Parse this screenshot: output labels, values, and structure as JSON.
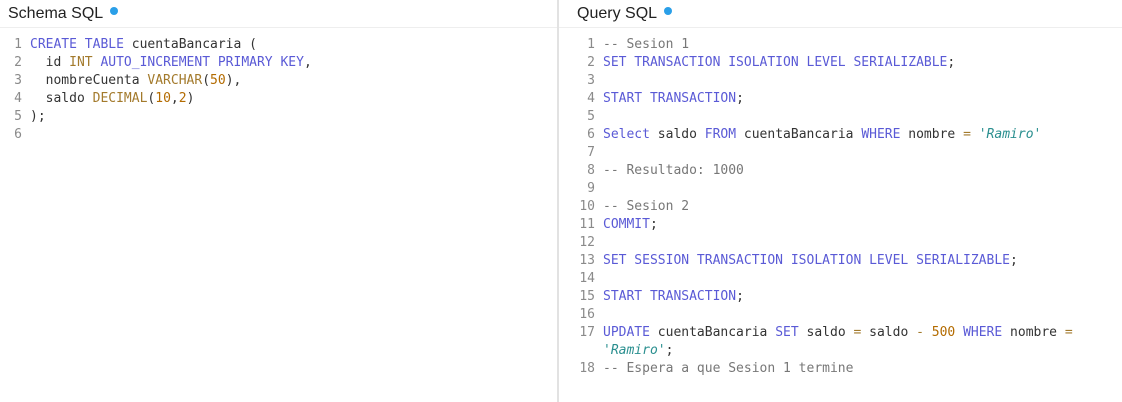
{
  "schema": {
    "title": "Schema SQL",
    "lines": [
      {
        "n": "1",
        "tokens": [
          {
            "t": "kw",
            "v": "CREATE TABLE"
          },
          {
            "t": "id",
            "v": " cuentaBancaria ("
          }
        ]
      },
      {
        "n": "2",
        "tokens": [
          {
            "t": "id",
            "v": "  id "
          },
          {
            "t": "type",
            "v": "INT"
          },
          {
            "t": "kw",
            "v": " AUTO_INCREMENT PRIMARY KEY"
          },
          {
            "t": "p",
            "v": ","
          }
        ]
      },
      {
        "n": "3",
        "tokens": [
          {
            "t": "id",
            "v": "  nombreCuenta "
          },
          {
            "t": "type",
            "v": "VARCHAR"
          },
          {
            "t": "p",
            "v": "("
          },
          {
            "t": "num",
            "v": "50"
          },
          {
            "t": "p",
            "v": "),"
          }
        ]
      },
      {
        "n": "4",
        "tokens": [
          {
            "t": "id",
            "v": "  saldo "
          },
          {
            "t": "type",
            "v": "DECIMAL"
          },
          {
            "t": "p",
            "v": "("
          },
          {
            "t": "num",
            "v": "10"
          },
          {
            "t": "p",
            "v": ","
          },
          {
            "t": "num",
            "v": "2"
          },
          {
            "t": "p",
            "v": ")"
          }
        ]
      },
      {
        "n": "5",
        "tokens": [
          {
            "t": "p",
            "v": ");"
          }
        ]
      },
      {
        "n": "6",
        "tokens": []
      }
    ]
  },
  "query": {
    "title": "Query SQL",
    "lines": [
      {
        "n": "1",
        "tokens": [
          {
            "t": "cm",
            "v": "-- Sesion 1"
          }
        ]
      },
      {
        "n": "2",
        "tokens": [
          {
            "t": "kw",
            "v": "SET TRANSACTION ISOLATION LEVEL SERIALIZABLE"
          },
          {
            "t": "p",
            "v": ";"
          }
        ]
      },
      {
        "n": "3",
        "tokens": []
      },
      {
        "n": "4",
        "tokens": [
          {
            "t": "kw",
            "v": "START TRANSACTION"
          },
          {
            "t": "p",
            "v": ";"
          }
        ]
      },
      {
        "n": "5",
        "tokens": []
      },
      {
        "n": "6",
        "tokens": [
          {
            "t": "kw",
            "v": "Select"
          },
          {
            "t": "id",
            "v": " saldo "
          },
          {
            "t": "kw",
            "v": "FROM"
          },
          {
            "t": "id",
            "v": " cuentaBancaria "
          },
          {
            "t": "kw",
            "v": "WHERE"
          },
          {
            "t": "id",
            "v": " nombre "
          },
          {
            "t": "op",
            "v": "="
          },
          {
            "t": "id",
            "v": " "
          },
          {
            "t": "str",
            "v": "'Ramiro'"
          }
        ]
      },
      {
        "n": "7",
        "tokens": []
      },
      {
        "n": "8",
        "tokens": [
          {
            "t": "cm",
            "v": "-- Resultado: 1000"
          }
        ]
      },
      {
        "n": "9",
        "tokens": []
      },
      {
        "n": "10",
        "tokens": [
          {
            "t": "cm",
            "v": "-- Sesion 2"
          }
        ]
      },
      {
        "n": "11",
        "tokens": [
          {
            "t": "kw",
            "v": "COMMIT"
          },
          {
            "t": "p",
            "v": ";"
          }
        ]
      },
      {
        "n": "12",
        "tokens": []
      },
      {
        "n": "13",
        "tokens": [
          {
            "t": "kw",
            "v": "SET SESSION TRANSACTION ISOLATION LEVEL SERIALIZABLE"
          },
          {
            "t": "p",
            "v": ";"
          }
        ]
      },
      {
        "n": "14",
        "tokens": []
      },
      {
        "n": "15",
        "tokens": [
          {
            "t": "kw",
            "v": "START TRANSACTION"
          },
          {
            "t": "p",
            "v": ";"
          }
        ]
      },
      {
        "n": "16",
        "tokens": []
      },
      {
        "n": "17",
        "tokens": [
          {
            "t": "kw",
            "v": "UPDATE"
          },
          {
            "t": "id",
            "v": " cuentaBancaria "
          },
          {
            "t": "kw",
            "v": "SET"
          },
          {
            "t": "id",
            "v": " saldo "
          },
          {
            "t": "op",
            "v": "="
          },
          {
            "t": "id",
            "v": " saldo "
          },
          {
            "t": "op",
            "v": "-"
          },
          {
            "t": "id",
            "v": " "
          },
          {
            "t": "num",
            "v": "500"
          },
          {
            "t": "id",
            "v": " "
          },
          {
            "t": "kw",
            "v": "WHERE"
          },
          {
            "t": "id",
            "v": " nombre "
          },
          {
            "t": "op",
            "v": "="
          }
        ]
      },
      {
        "n": "",
        "tokens": [
          {
            "t": "str",
            "v": "'Ramiro'"
          },
          {
            "t": "p",
            "v": ";"
          }
        ]
      },
      {
        "n": "18",
        "tokens": [
          {
            "t": "cm",
            "v": "-- Espera a que Sesion 1 termine"
          }
        ]
      }
    ]
  },
  "colors": {
    "accent": "#2a9fe8",
    "keyword": "#5a5ad6",
    "type": "#a37a2c",
    "number": "#b36b00",
    "string": "#2a8f8f",
    "comment": "#777777"
  },
  "icons": {
    "status_dot": "status-dot-icon"
  }
}
